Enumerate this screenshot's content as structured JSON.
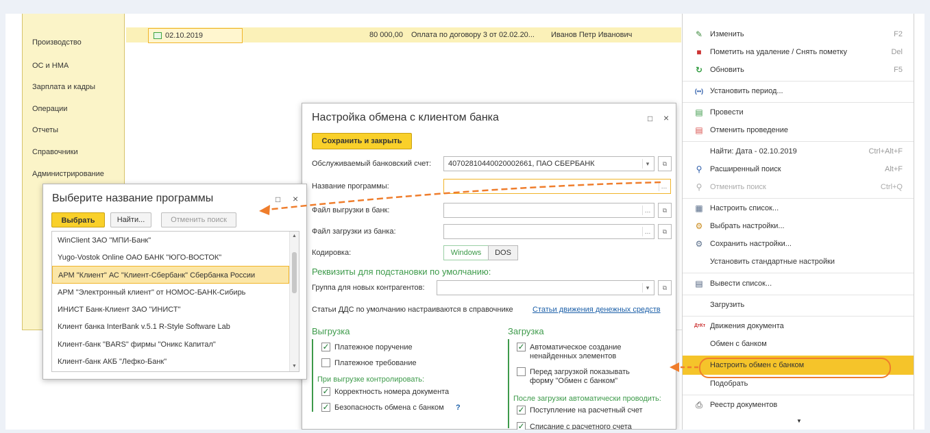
{
  "sections": [
    "Производство",
    "ОС и НМА",
    "Зарплата и кадры",
    "Операции",
    "Отчеты",
    "Справочники",
    "Администрирование"
  ],
  "doc_row": {
    "date": "02.10.2019",
    "amount": "80 000,00",
    "purpose": "Оплата по договору 3 от 02.02.20...",
    "person": "Иванов Петр Иванович"
  },
  "context_menu": [
    {
      "label": "Изменить",
      "shortcut": "F2",
      "icon": "pencil-icon"
    },
    {
      "label": "Пометить на удаление / Снять пометку",
      "shortcut": "Del",
      "icon": "delete-mark-icon"
    },
    {
      "label": "Обновить",
      "shortcut": "F5",
      "icon": "refresh-icon"
    },
    {
      "label": "Установить период...",
      "shortcut": "",
      "icon": "period-icon"
    },
    {
      "label": "Провести",
      "shortcut": "",
      "icon": "post-icon"
    },
    {
      "label": "Отменить проведение",
      "shortcut": "",
      "icon": "unpost-icon"
    },
    {
      "label": "Найти: Дата - 02.10.2019",
      "shortcut": "Ctrl+Alt+F",
      "icon": ""
    },
    {
      "label": "Расширенный поиск",
      "shortcut": "Alt+F",
      "icon": "search-icon"
    },
    {
      "label": "Отменить поиск",
      "shortcut": "Ctrl+Q",
      "icon": "cancel-search-icon"
    },
    {
      "label": "Настроить список...",
      "shortcut": "",
      "icon": "list-settings-icon"
    },
    {
      "label": "Выбрать настройки...",
      "shortcut": "",
      "icon": "choose-settings-icon"
    },
    {
      "label": "Сохранить настройки...",
      "shortcut": "",
      "icon": "save-settings-icon"
    },
    {
      "label": "Установить стандартные настройки",
      "shortcut": "",
      "icon": ""
    },
    {
      "label": "Вывести список...",
      "shortcut": "",
      "icon": "output-list-icon"
    },
    {
      "label": "Загрузить",
      "shortcut": "",
      "icon": ""
    },
    {
      "label": "Движения документа",
      "shortcut": "",
      "icon": "dt-kt-icon"
    },
    {
      "label": "Обмен с банком",
      "shortcut": "",
      "icon": ""
    },
    {
      "label": "Настроить обмен с банком",
      "shortcut": "",
      "icon": ""
    },
    {
      "label": "Подобрать",
      "shortcut": "",
      "icon": ""
    },
    {
      "label": "Реестр документов",
      "shortcut": "",
      "icon": "printer-icon"
    }
  ],
  "dialog": {
    "title": "Настройка обмена с клиентом банка",
    "save_close": "Сохранить и закрыть",
    "bank_account_label": "Обслуживаемый банковский счет:",
    "bank_account_value": "40702810440020002661, ПАО СБЕРБАНК",
    "program_label": "Название программы:",
    "program_value": "",
    "export_file_label": "Файл выгрузки в банк:",
    "export_file_value": "",
    "import_file_label": "Файл загрузки из банка:",
    "import_file_value": "",
    "encoding_label": "Кодировка:",
    "encoding_options": [
      "Windows",
      "DOS"
    ],
    "encoding_selected": "Windows",
    "defaults_header": "Реквизиты для подстановки по умолчанию:",
    "group_label": "Группа для новых контрагентов:",
    "group_value": "",
    "dds_text": "Статьи ДДС по умолчанию настраиваются в справочнике",
    "dds_link": "Статьи движения денежных средств",
    "export_header": "Выгрузка",
    "export_items": [
      {
        "label": "Платежное поручение",
        "checked": true
      },
      {
        "label": "Платежное требование",
        "checked": false
      }
    ],
    "export_control_header": "При выгрузке контролировать:",
    "export_control_items": [
      {
        "label": "Корректность номера документа",
        "checked": true
      },
      {
        "label": "Безопасность обмена с банком",
        "checked": true
      }
    ],
    "help_mark": "?",
    "import_header": "Загрузка",
    "import_items": [
      {
        "label": "Автоматическое создание ненайденных элементов",
        "checked": true
      },
      {
        "label": "Перед загрузкой показывать форму \"Обмен с банком\"",
        "checked": false
      }
    ],
    "import_post_header": "После загрузки автоматически проводить:",
    "import_post_items": [
      {
        "label": "Поступление на расчетный счет",
        "checked": true
      },
      {
        "label": "Списание с расчетного счета",
        "checked": true
      }
    ]
  },
  "picker": {
    "title": "Выберите название программы",
    "select_btn": "Выбрать",
    "find_btn": "Найти...",
    "cancel_search_btn": "Отменить поиск",
    "items": [
      "WinClient ЗАО \"МПИ-Банк\"",
      "Yugo-Vostok Online ОАО БАНК \"ЮГО-ВОСТОК\"",
      "АРМ \"Клиент\" АС \"Клиент-Сбербанк\" Сбербанка России",
      "АРМ \"Электронный клиент\" от НОМОС-БАНК-Сибирь",
      "ИНИСТ Банк-Клиент ЗАО \"ИНИСТ\"",
      "Клиент банка InterBank v.5.1 R-Style Software Lab",
      "Клиент-банк \"BARS\" фирмы \"Оникс Капитал\"",
      "Клиент-банк АКБ \"Лефко-Банк\""
    ],
    "selected_index": 2
  },
  "colors": {
    "accent": "#f5c42a",
    "arrow": "#ef7d2c",
    "green": "#3d9a4a",
    "link": "#1b5fa8"
  }
}
